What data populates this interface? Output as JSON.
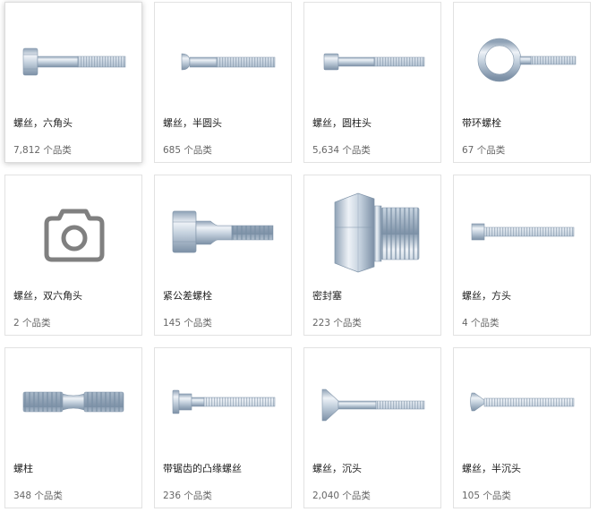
{
  "products": [
    {
      "name": "螺丝，六角头",
      "count": "7,812 个品类",
      "icon": "hex-head-bolt-icon"
    },
    {
      "name": "螺丝，半圆头",
      "count": "685 个品类",
      "icon": "button-head-screw-icon"
    },
    {
      "name": "螺丝，圆柱头",
      "count": "5,634 个品类",
      "icon": "cylinder-head-screw-icon"
    },
    {
      "name": "带环螺栓",
      "count": "67 个品类",
      "icon": "eye-bolt-icon"
    },
    {
      "name": "螺丝，双六角头",
      "count": "2 个品类",
      "icon": "camera-placeholder-icon"
    },
    {
      "name": "紧公差螺栓",
      "count": "145 个品类",
      "icon": "tight-tolerance-bolt-icon"
    },
    {
      "name": "密封塞",
      "count": "223 个品类",
      "icon": "sealing-plug-icon"
    },
    {
      "name": "螺丝，方头",
      "count": "4 个品类",
      "icon": "square-head-screw-icon"
    },
    {
      "name": "螺柱",
      "count": "348 个品类",
      "icon": "stud-bolt-icon"
    },
    {
      "name": "带锯齿的凸缘螺丝",
      "count": "236 个品类",
      "icon": "serrated-flange-screw-icon"
    },
    {
      "name": "螺丝，沉头",
      "count": "2,040 个品类",
      "icon": "countersunk-screw-icon"
    },
    {
      "name": "螺丝，半沉头",
      "count": "105 个品类",
      "icon": "raised-countersunk-screw-icon"
    }
  ],
  "colors": {
    "metal_light": "#dfe6ee",
    "metal_mid": "#b4c3d3",
    "metal_dark": "#8296ab",
    "thread": "#a8b8ca",
    "placeholder_gray": "#808080"
  }
}
